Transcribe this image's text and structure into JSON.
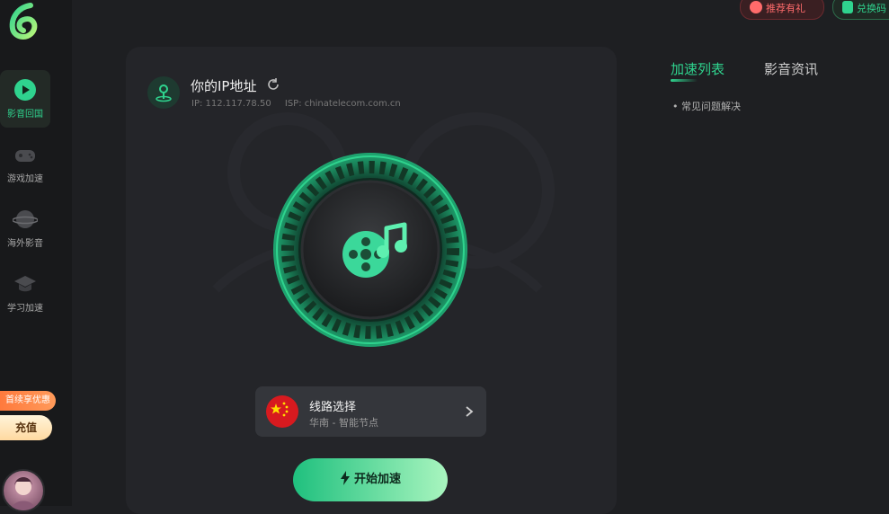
{
  "sidebar": {
    "items": [
      {
        "label": "影音回国",
        "icon": "play-icon",
        "active": true
      },
      {
        "label": "游戏加速",
        "icon": "gamepad-icon",
        "active": false
      },
      {
        "label": "海外影音",
        "icon": "planet-icon",
        "active": false
      },
      {
        "label": "学习加速",
        "icon": "graduation-cap-icon",
        "active": false
      }
    ],
    "promo_badge": "首续享优惠",
    "recharge_label": "充值"
  },
  "topbar": {
    "refer_label": "推荐有礼",
    "redeem_label": "兑换码"
  },
  "ip_panel": {
    "title": "你的IP地址",
    "ip_text": "IP: 112.117.78.50",
    "isp_text": "ISP: chinatelecom.com.cn"
  },
  "route": {
    "title": "线路选择",
    "subtitle": "华南 - 智能节点"
  },
  "start_button": {
    "label": "开始加速"
  },
  "right_panel": {
    "tabs": [
      {
        "label": "加速列表",
        "active": true
      },
      {
        "label": "影音资讯",
        "active": false
      }
    ],
    "faq_item": "• 常见问题解决"
  },
  "colors": {
    "accent": "#2fd38e",
    "background": "#1e1f22",
    "panel": "#242529",
    "sidebar": "#18191b"
  }
}
